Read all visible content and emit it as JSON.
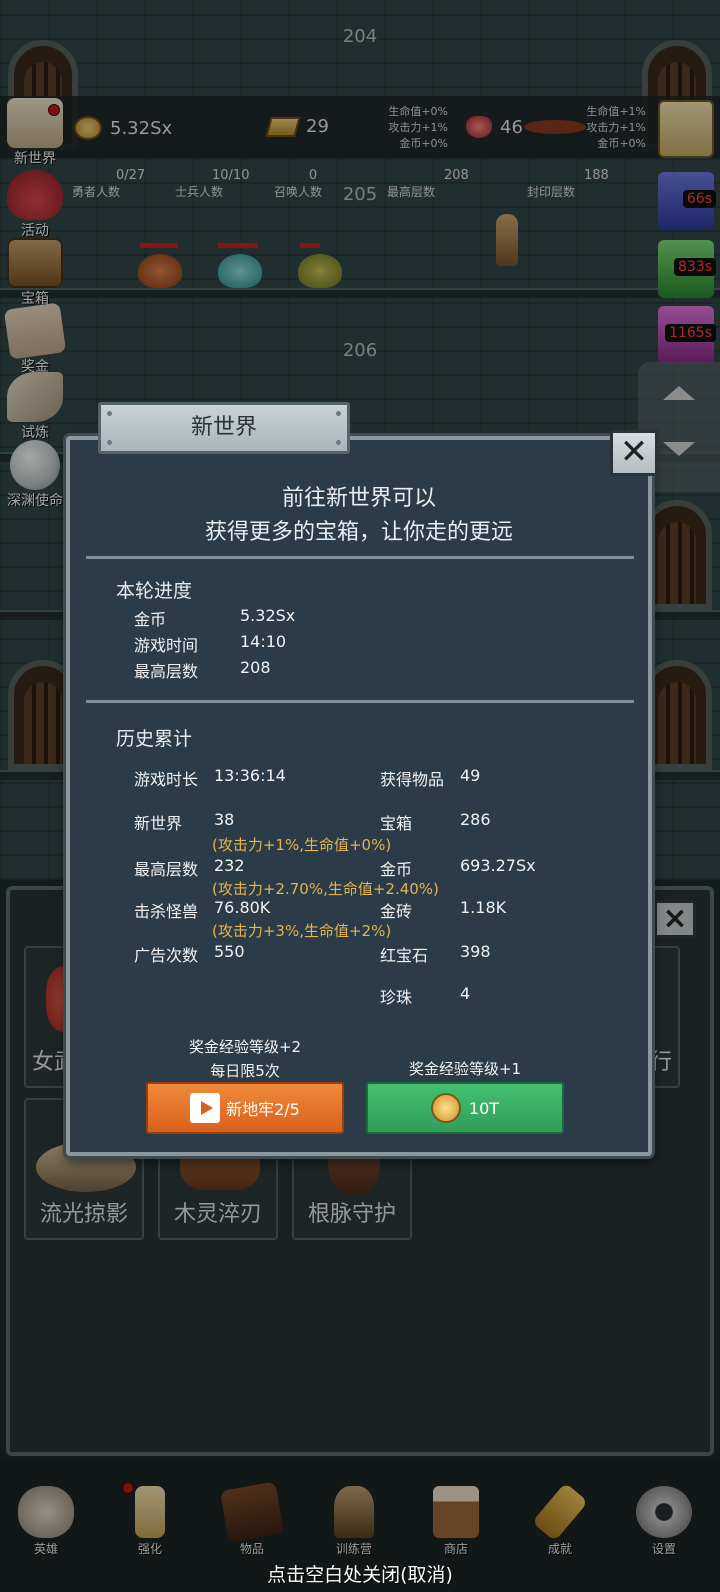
{
  "floors": [
    "204",
    "205",
    "206"
  ],
  "resources": {
    "gold": "5.32Sx",
    "gold_bricks": "29",
    "rubies": "46",
    "bonus_left": [
      "生命值+0%",
      "攻击力+1%",
      "金币+0%"
    ],
    "bonus_right": [
      "生命值+1%",
      "攻击力+1%",
      "金币+0%"
    ]
  },
  "stats_bar": [
    {
      "value": "0/27",
      "label": "勇者人数"
    },
    {
      "value": "10/10",
      "label": "士兵人数"
    },
    {
      "value": "0",
      "label": "召唤人数"
    },
    {
      "value": "208",
      "label": "最高层数"
    },
    {
      "value": "188",
      "label": "封印层数"
    }
  ],
  "side_menu": [
    "新世界",
    "活动",
    "宝箱",
    "奖金",
    "试炼",
    "深渊使命"
  ],
  "timers": [
    "66s",
    "833s",
    "1165s"
  ],
  "modal": {
    "title": "新世界",
    "close": "✕",
    "intro_line1": "前往新世界可以",
    "intro_line2": "获得更多的宝箱，让你走的更远",
    "round_title": "本轮进度",
    "round": [
      {
        "label": "金币",
        "value": "5.32Sx"
      },
      {
        "label": "游戏时间",
        "value": "14:10"
      },
      {
        "label": "最高层数",
        "value": "208"
      }
    ],
    "history_title": "历史累计",
    "history_left": [
      {
        "label": "游戏时长",
        "value": "13:36:14"
      },
      {
        "label": "新世界",
        "value": "38"
      },
      {
        "label": "最高层数",
        "value": "232"
      },
      {
        "label": "击杀怪兽",
        "value": "76.80K"
      },
      {
        "label": "广告次数",
        "value": "550"
      }
    ],
    "history_notes": [
      "(攻击力+1%,生命值+0%)",
      "(攻击力+2.70%,生命值+2.40%)",
      "(攻击力+3%,生命值+2%)"
    ],
    "history_right": [
      {
        "label": "获得物品",
        "value": "49"
      },
      {
        "label": "宝箱",
        "value": "286"
      },
      {
        "label": "金币",
        "value": "693.27Sx"
      },
      {
        "label": "金砖",
        "value": "1.18K"
      },
      {
        "label": "红宝石",
        "value": "398"
      },
      {
        "label": "珍珠",
        "value": "4"
      }
    ],
    "left_caption1": "奖金经验等级+2",
    "left_caption2": "每日限5次",
    "left_button": "新地牢2/5",
    "right_caption": "奖金经验等级+1",
    "right_button": "10T"
  },
  "shop": {
    "cards": [
      "女武",
      "流光掠影",
      "木灵淬刃",
      "根脉守护",
      "行"
    ]
  },
  "bottom_nav": [
    "英雄",
    "强化",
    "物品",
    "训练营",
    "商店",
    "成就",
    "设置"
  ],
  "close_hint": "点击空白处关闭(取消)",
  "colors": {
    "accent_orange": "#d8611c",
    "accent_green": "#2f9e58",
    "note_gold": "#e3b44f",
    "modal_bg": "#2b3b47"
  }
}
